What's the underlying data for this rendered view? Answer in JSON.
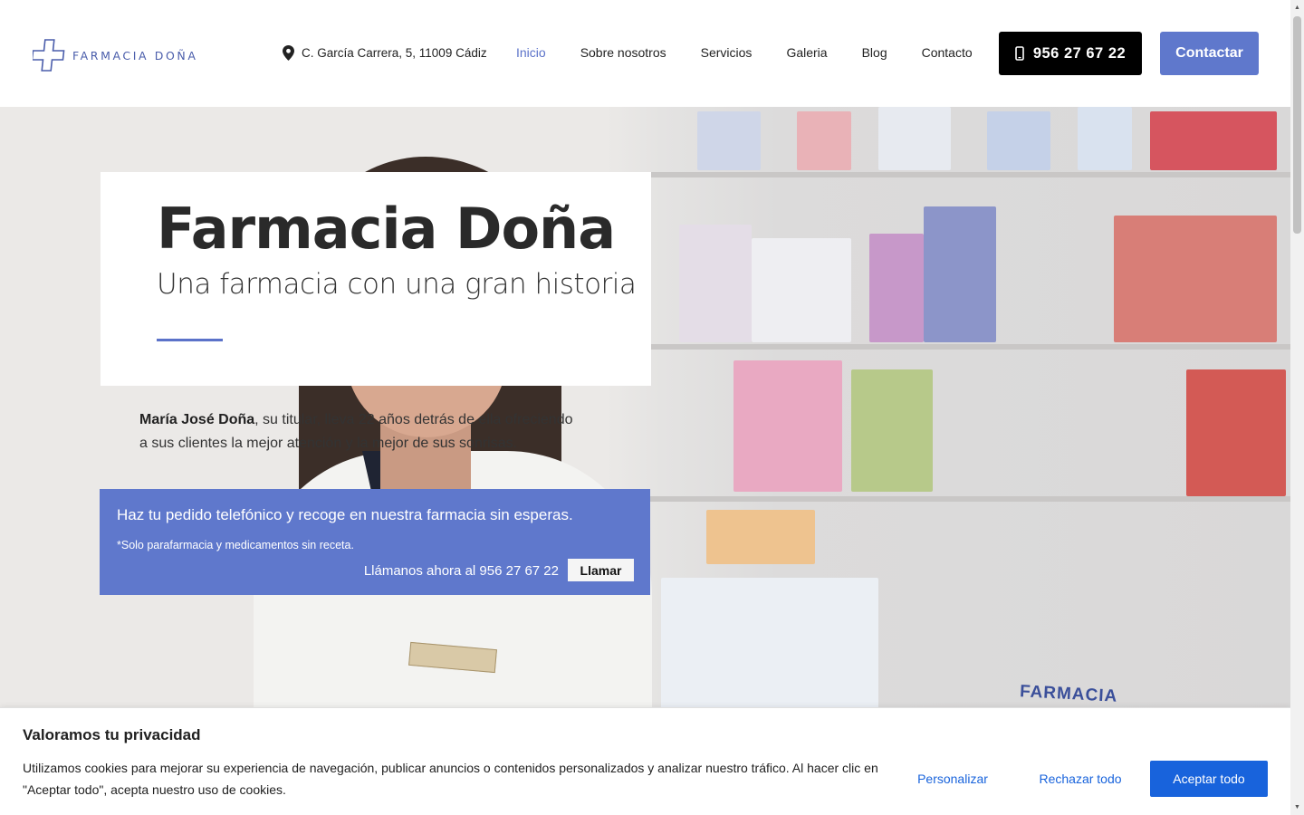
{
  "brand": {
    "logo_text": "FARMACIA DOÑA"
  },
  "header": {
    "address": "C. García Carrera, 5, 11009 Cádiz",
    "nav": [
      "Inicio",
      "Sobre nosotros",
      "Servicios",
      "Galeria",
      "Blog",
      "Contacto"
    ],
    "active_nav": "Inicio",
    "phone": "956 27 67 22",
    "contact_label": "Contactar"
  },
  "hero": {
    "title": "Farmacia Doña",
    "subtitle": "Una farmacia con una gran historia",
    "intro_name": "María José Doña",
    "intro_rest": ", su titular, lleva 22 años detrás de ella ofreciendo a sus clientes la mejor atención y la mejor de sus sonrisas.",
    "coat_label": "FARMACIA"
  },
  "order": {
    "title": "Haz tu pedido telefónico y recoge en nuestra farmacia sin esperas.",
    "note": "*Solo parafarmacia y medicamentos sin receta.",
    "call_text": "Llámanos ahora al 956 27 67 22",
    "call_button": "Llamar"
  },
  "cookie": {
    "title": "Valoramos tu privacidad",
    "text": "Utilizamos cookies para mejorar su experiencia de navegación, publicar anuncios o contenidos personalizados y analizar nuestro tráfico. Al hacer clic en \"Aceptar todo\", acepta nuestro uso de cookies.",
    "customize": "Personalizar",
    "reject": "Rechazar todo",
    "accept": "Aceptar todo"
  },
  "colors": {
    "accent": "#5f78cc",
    "cookie_blue": "#1863dc"
  },
  "icons": [
    "logo-cross-icon",
    "map-pin-icon",
    "mobile-phone-icon"
  ]
}
